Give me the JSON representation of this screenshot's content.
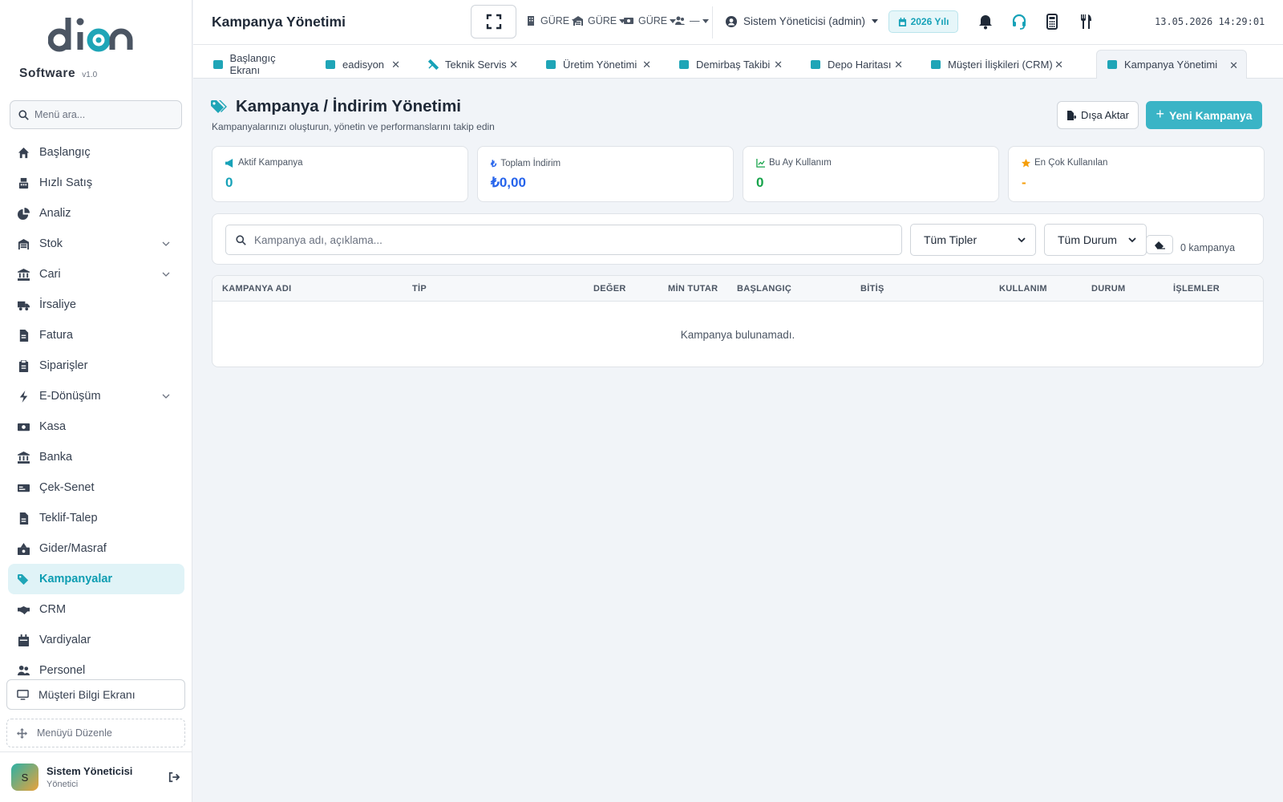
{
  "sidebar": {
    "brand": "Software",
    "version": "v1.0",
    "search_placeholder": "Menü ara...",
    "items": [
      {
        "label": "Başlangıç",
        "icon": "home-icon"
      },
      {
        "label": "Hızlı Satış",
        "icon": "cash-register-icon"
      },
      {
        "label": "Analiz",
        "icon": "pie-chart-icon"
      },
      {
        "label": "Stok",
        "icon": "warehouse-icon",
        "expandable": true
      },
      {
        "label": "Cari",
        "icon": "bank-icon",
        "expandable": true
      },
      {
        "label": "İrsaliye",
        "icon": "truck-icon"
      },
      {
        "label": "Fatura",
        "icon": "invoice-icon"
      },
      {
        "label": "Siparişler",
        "icon": "clipboard-icon"
      },
      {
        "label": "E-Dönüşüm",
        "icon": "bolt-icon",
        "expandable": true
      },
      {
        "label": "Kasa",
        "icon": "money-icon"
      },
      {
        "label": "Banka",
        "icon": "bank-icon"
      },
      {
        "label": "Çek-Senet",
        "icon": "card-icon"
      },
      {
        "label": "Teklif-Talep",
        "icon": "document-icon"
      },
      {
        "label": "Gider/Masraf",
        "icon": "expense-icon"
      },
      {
        "label": "Kampanyalar",
        "icon": "tags-icon",
        "active": true
      },
      {
        "label": "CRM",
        "icon": "handshake-icon"
      },
      {
        "label": "Vardiyalar",
        "icon": "calendar-icon"
      },
      {
        "label": "Personel",
        "icon": "users-icon"
      }
    ],
    "customer_screen": "Müşteri Bilgi Ekranı",
    "edit_menu": "Menüyü Düzenle",
    "user": {
      "name": "Sistem Yöneticisi",
      "role": "Yönetici",
      "initial": "S"
    }
  },
  "topbar": {
    "title": "Kampanya Yönetimi",
    "selectors": [
      "GÜRE",
      "GÜRE",
      "GÜRE",
      "—"
    ],
    "admin": "Sistem Yöneticisi (admin)",
    "year": "2026 Yılı",
    "datetime": "13.05.2026 14:29:01"
  },
  "tabs": [
    {
      "label": "Başlangıç Ekranı"
    },
    {
      "label": "eadisyon"
    },
    {
      "label": "Teknik Servis"
    },
    {
      "label": "Üretim Yönetimi"
    },
    {
      "label": "Demirbaş Takibi"
    },
    {
      "label": "Depo Haritası"
    },
    {
      "label": "Müşteri İlişkileri (CRM)"
    },
    {
      "label": "Kampanya Yönetimi",
      "active": true
    }
  ],
  "page": {
    "title": "Kampanya / İndirim Yönetimi",
    "subtitle": "Kampanyalarınızı oluşturun, yönetin ve performanslarını takip edin",
    "export_label": "Dışa Aktar",
    "new_label": "Yeni Kampanya"
  },
  "stats": [
    {
      "label": "Aktif Kampanya",
      "value": "0",
      "color": "#17a2b8",
      "icon": "megaphone-icon"
    },
    {
      "label": "Toplam İndirim",
      "value": "₺0,00",
      "color": "#2563eb",
      "icon": "lira-icon"
    },
    {
      "label": "Bu Ay Kullanım",
      "value": "0",
      "color": "#16a34a",
      "icon": "line-chart-icon"
    },
    {
      "label": "En Çok Kullanılan",
      "value": "-",
      "color": "#f59e0b",
      "icon": "star-icon"
    }
  ],
  "filters": {
    "search_placeholder": "Kampanya adı, açıklama...",
    "type_value": "Tüm Tipler",
    "status_value": "Tüm Durum",
    "count": "0 kampanya"
  },
  "table": {
    "columns": [
      "KAMPANYA ADI",
      "TİP",
      "DEĞER",
      "MİN TUTAR",
      "BAŞLANGIÇ",
      "BİTİŞ",
      "KULLANIM",
      "DURUM",
      "İŞLEMLER"
    ],
    "empty": "Kampanya bulunamadı."
  },
  "colors": {
    "accent": "#1fa5b7",
    "accent_button": "#3ab4c6",
    "active_bg": "#e0f3f7"
  }
}
